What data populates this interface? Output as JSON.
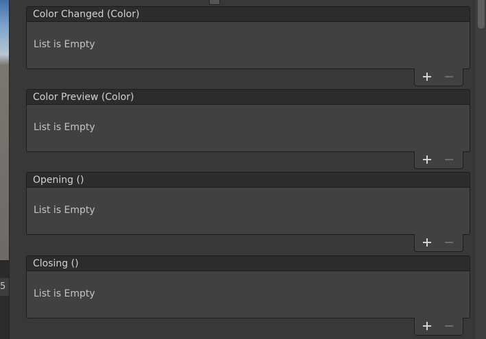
{
  "scene": {
    "partial_number": "5"
  },
  "events": [
    {
      "label": "Color Changed (Color)",
      "empty_text": "List is Empty"
    },
    {
      "label": "Color Preview (Color)",
      "empty_text": "List is Empty"
    },
    {
      "label": "Opening ()",
      "empty_text": "List is Empty"
    },
    {
      "label": "Closing ()",
      "empty_text": "List is Empty"
    }
  ],
  "icons": {
    "add": "plus-icon",
    "remove": "minus-icon"
  },
  "colors": {
    "background": "#383838",
    "header": "#2c2c2c",
    "body": "#414141",
    "border": "#1d1d1d"
  }
}
